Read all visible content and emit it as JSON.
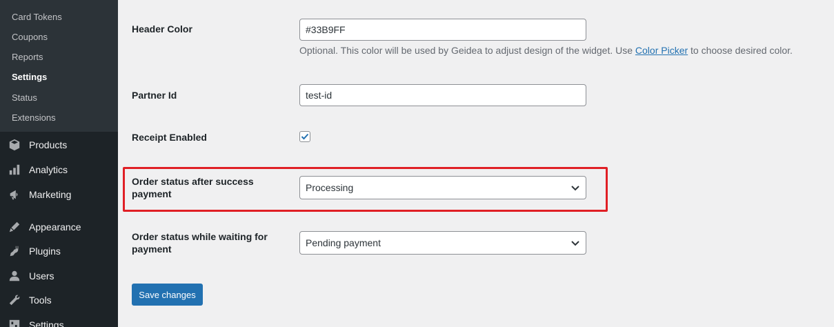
{
  "sidebar": {
    "submenu": [
      "Card Tokens",
      "Coupons",
      "Reports",
      "Settings",
      "Status",
      "Extensions"
    ],
    "menu": [
      {
        "label": "Products",
        "icon": "products-icon"
      },
      {
        "label": "Analytics",
        "icon": "analytics-icon"
      },
      {
        "label": "Marketing",
        "icon": "marketing-icon"
      },
      {
        "label": "Appearance",
        "icon": "appearance-icon"
      },
      {
        "label": "Plugins",
        "icon": "plugins-icon"
      },
      {
        "label": "Users",
        "icon": "users-icon"
      },
      {
        "label": "Tools",
        "icon": "tools-icon"
      },
      {
        "label": "Settings",
        "icon": "settings-icon"
      }
    ]
  },
  "form": {
    "header_color": {
      "label": "Header Color",
      "value": "#33B9FF",
      "description": "Optional. This color will be used by Geidea to adjust design of the widget. Use ",
      "link": "Color Picker",
      "description_end": " to choose desired color."
    },
    "partner_id": {
      "label": "Partner Id",
      "value": "test-id"
    },
    "receipt": {
      "label": "Receipt Enabled",
      "checked": true
    },
    "order_success": {
      "label": "Order status after success payment",
      "value": "Processing"
    },
    "order_waiting": {
      "label": "Order status while waiting for payment",
      "value": "Pending payment"
    },
    "save_label": "Save changes"
  },
  "colors": {
    "accent": "#2271b1",
    "highlight": "#e01f25",
    "sidebar": "#1d2327"
  }
}
